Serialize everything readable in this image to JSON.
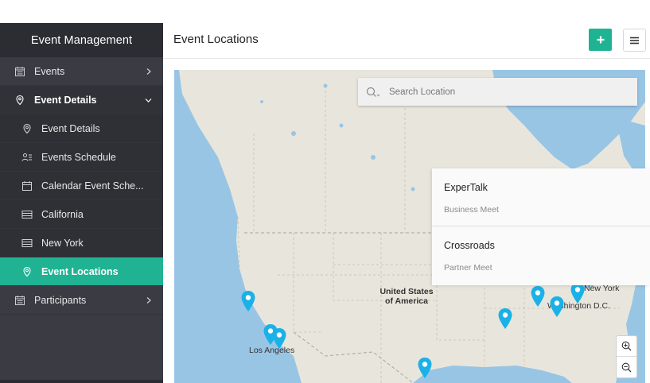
{
  "sidebar": {
    "title": "Event Management",
    "items": [
      {
        "label": "Events",
        "icon": "calendar-list-icon"
      },
      {
        "label": "Event Details",
        "icon": "map-pin-icon"
      },
      {
        "label": "Participants",
        "icon": "calendar-list-icon"
      }
    ],
    "subitems": [
      {
        "label": "Event Details",
        "icon": "map-pin-icon"
      },
      {
        "label": "Events Schedule",
        "icon": "schedule-icon"
      },
      {
        "label": "Calendar Event Sche...",
        "icon": "calendar-icon"
      },
      {
        "label": "California",
        "icon": "list-icon"
      },
      {
        "label": "New York",
        "icon": "list-icon"
      },
      {
        "label": "Event Locations",
        "icon": "map-pin-icon"
      }
    ]
  },
  "header": {
    "title": "Event Locations"
  },
  "map": {
    "search_placeholder": "Search Location",
    "labels": {
      "country_line1": "United States",
      "country_line2": "of America",
      "los_angeles": "Los Angeles",
      "new_york": "New York",
      "washington": "Washington D.C."
    },
    "events": [
      {
        "title": "ExperTalk",
        "subtitle": "Business Meet"
      },
      {
        "title": "Crossroads",
        "subtitle": "Partner Meet"
      }
    ]
  },
  "colors": {
    "accent": "#1fb394",
    "sidebar_bg": "#3a3b43",
    "pin": "#1ab1e8",
    "water": "#99c5e5",
    "land": "#e8e6dc"
  }
}
